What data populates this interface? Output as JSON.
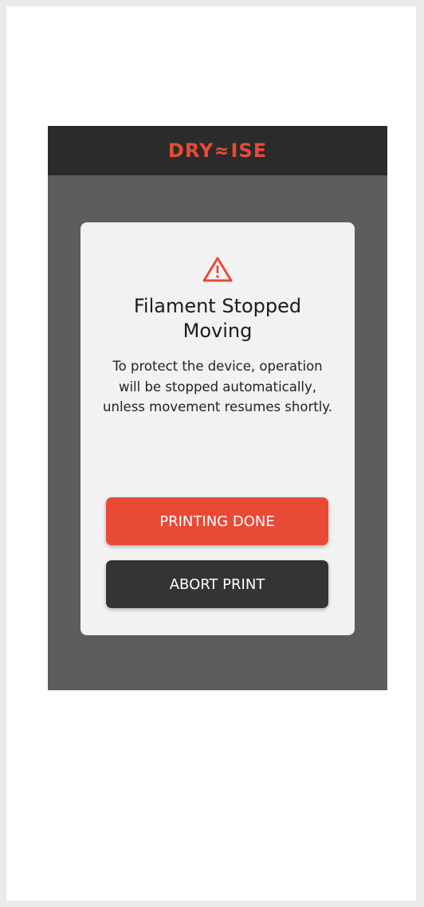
{
  "app": {
    "brand": "DRY⌇ISE",
    "brand_color": "#e84a36"
  },
  "dialog": {
    "icon": "warning-triangle-icon",
    "title": "Filament Stopped Moving",
    "message": "To protect the device, operation will be stopped automatically, unless movement resumes shortly.",
    "primary_button": "PRINTING DONE",
    "secondary_button": "ABORT PRINT"
  },
  "colors": {
    "accent": "#e84a36",
    "topbar": "#2b2b2b",
    "overlay": "#5d5d5d",
    "dialog_bg": "#f2f2f2",
    "secondary_button": "#343434"
  }
}
